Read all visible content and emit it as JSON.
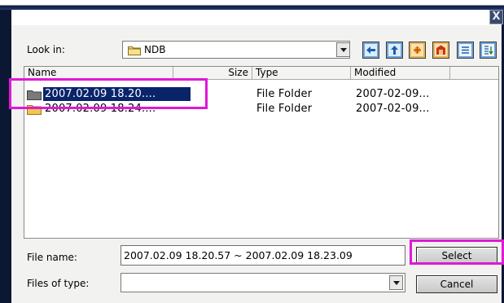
{
  "window": {
    "close_glyph": "X"
  },
  "look_in": {
    "label": "Look in:",
    "value": "NDB"
  },
  "toolbar": {
    "buttons": [
      {
        "name": "back-icon"
      },
      {
        "name": "up-folder-icon"
      },
      {
        "name": "new-folder-icon"
      },
      {
        "name": "home-icon"
      },
      {
        "name": "list-view-icon"
      },
      {
        "name": "details-view-icon"
      }
    ]
  },
  "file_list": {
    "columns": [
      "Name",
      "Size",
      "Type",
      "Modified"
    ],
    "rows": [
      {
        "name": "2007.02.09 18.20....",
        "size": "",
        "type": "File Folder",
        "modified": "2007-02-09...",
        "selected": true
      },
      {
        "name": "2007.02.09 18.24....",
        "size": "",
        "type": "File Folder",
        "modified": "2007-02-09...",
        "selected": false
      }
    ]
  },
  "file_name": {
    "label": "File name:",
    "value": "2007.02.09 18.20.57 ~ 2007.02.09 18.23.09"
  },
  "files_of_type": {
    "label": "Files of type:",
    "value": ""
  },
  "buttons": {
    "select": "Select",
    "cancel": "Cancel"
  },
  "colors": {
    "highlight": "#e018d7",
    "selection": "#0a246a",
    "frame": "#0c1733"
  }
}
